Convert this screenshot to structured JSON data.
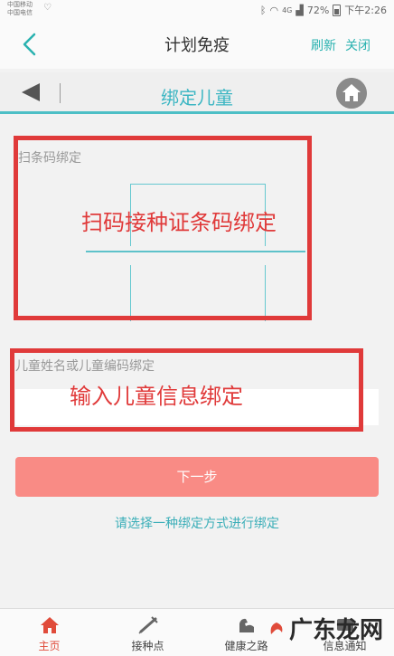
{
  "status_bar": {
    "carrier_1": "中国移动",
    "carrier_2": "中国电信",
    "signal_text": "4G",
    "battery": "72%",
    "time": "下午2:26"
  },
  "app_bar": {
    "title": "计划免疫",
    "refresh": "刷新",
    "close": "关闭"
  },
  "sub_header": {
    "title": "绑定儿童"
  },
  "scan_section": {
    "label": "扫条码绑定",
    "annotation": "扫码接种证条码绑定"
  },
  "name_section": {
    "label": "儿童姓名或儿童编码绑定",
    "annotation": "输入儿童信息绑定",
    "input_value": ""
  },
  "next_button": {
    "label": "下一步"
  },
  "hint": "请选择一种绑定方式进行绑定",
  "tabs": [
    {
      "label": "主页",
      "active": true
    },
    {
      "label": "接种点",
      "active": false
    },
    {
      "label": "健康之路",
      "active": false
    },
    {
      "label": "信息通知",
      "active": false
    }
  ],
  "watermark": "广东龙网",
  "colors": {
    "teal": "#3cb6c3",
    "red_annotation": "#e03a3a",
    "next_button": "#f98b85",
    "tab_active": "#e04b3a"
  }
}
